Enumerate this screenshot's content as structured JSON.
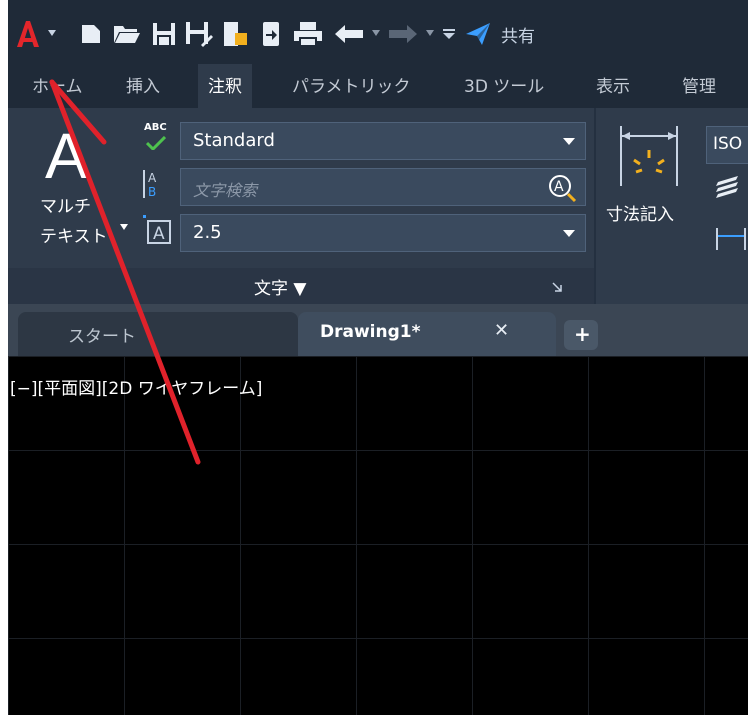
{
  "colors": {
    "app_logo": "#e3262b",
    "accent_blue": "#3b9eff",
    "toolbar_bg": "#1f2a38",
    "ribbon_bg": "#2f3b4b",
    "annotation_arrow": "#e0222b"
  },
  "quick_access": {
    "share_label": "共有",
    "icons": [
      "app-logo-icon",
      "new-file-icon",
      "open-folder-icon",
      "save-icon",
      "save-as-icon",
      "publish-icon",
      "export-icon",
      "print-icon",
      "undo-icon",
      "redo-icon",
      "customize-icon",
      "share-icon"
    ]
  },
  "ribbon_tabs": [
    {
      "label": "ホーム",
      "active": false
    },
    {
      "label": "挿入",
      "active": false
    },
    {
      "label": "注釈",
      "active": true
    },
    {
      "label": "パラメトリック",
      "active": false
    },
    {
      "label": "3D ツール",
      "active": false
    },
    {
      "label": "表示",
      "active": false
    },
    {
      "label": "管理",
      "active": false
    }
  ],
  "text_panel": {
    "multitext_line1": "マルチ",
    "multitext_line2": "テキスト",
    "big_glyph": "A",
    "abc_badge": "ABC",
    "style_value": "Standard",
    "search_placeholder": "文字検索",
    "height_value": "2.5",
    "panel_title": "文字 ▼"
  },
  "dimension_panel": {
    "label": "寸法記入",
    "style_value": "ISO"
  },
  "file_tabs": {
    "start": "スタート",
    "drawing": "Drawing1*",
    "close_glyph": "✕",
    "add_glyph": "+"
  },
  "viewport": {
    "label": "[−][平面図][2D ワイヤフレーム]"
  }
}
